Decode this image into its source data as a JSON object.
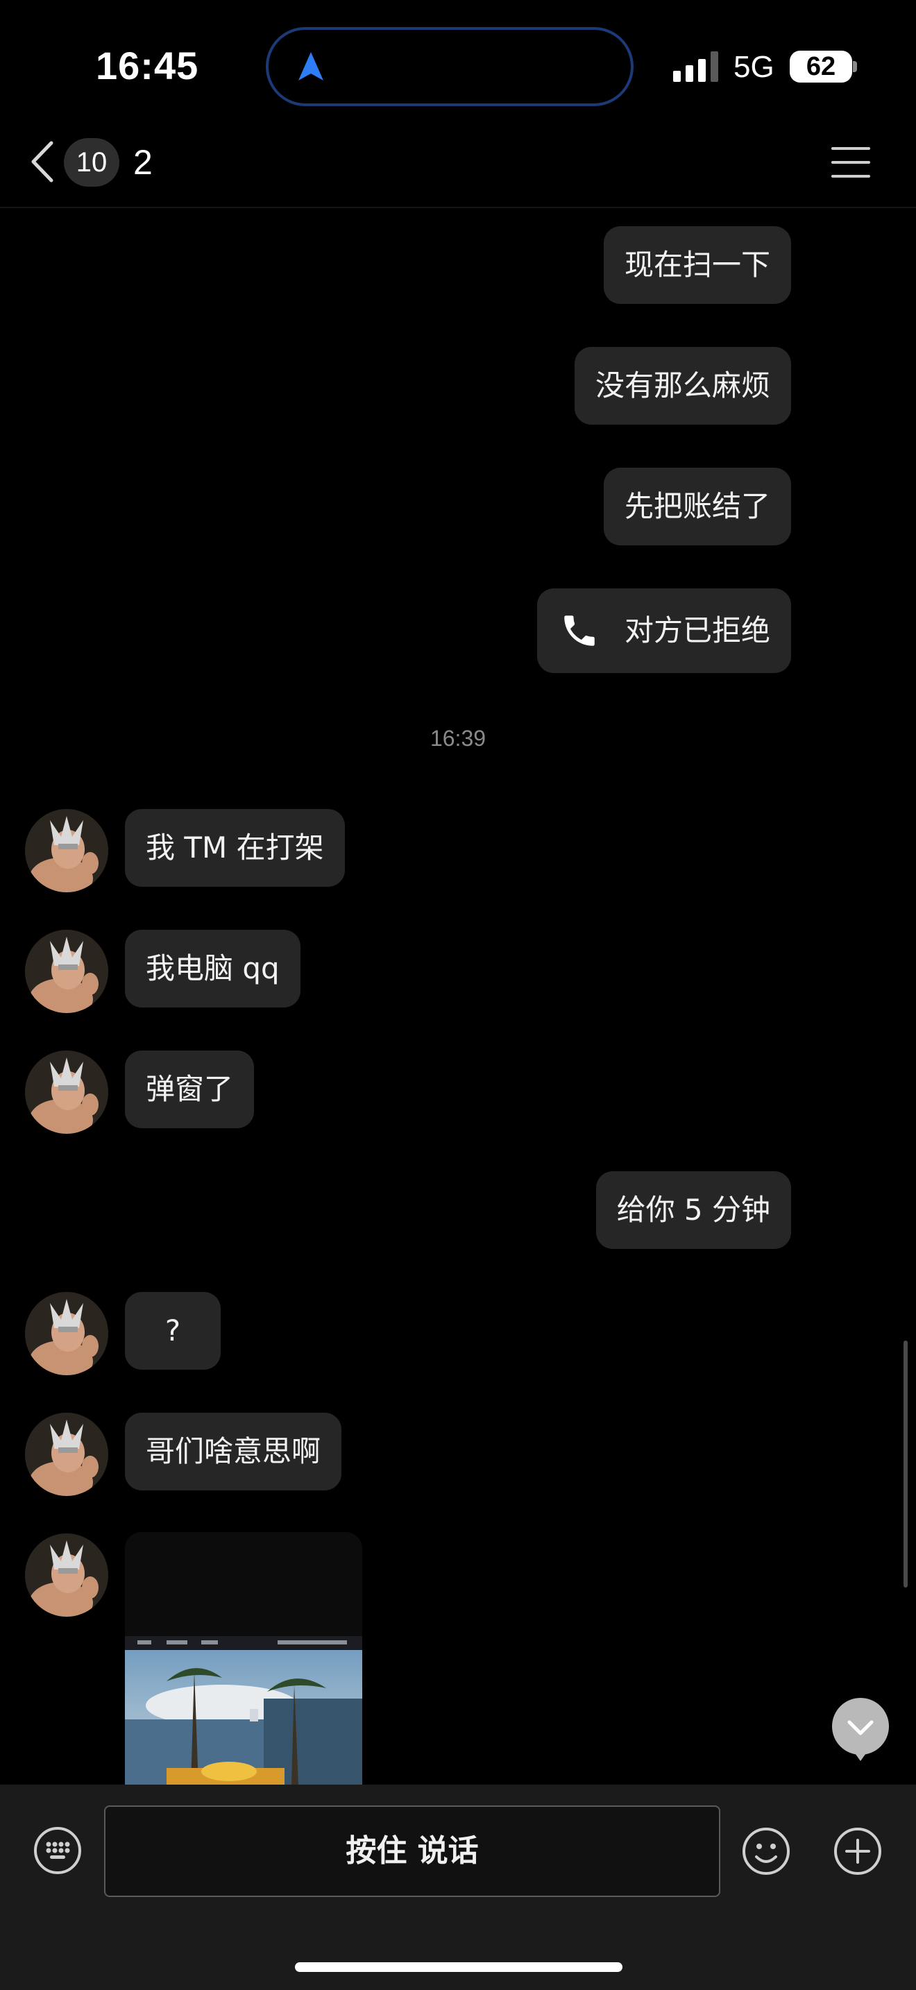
{
  "status_bar": {
    "time": "16:45",
    "network": "5G",
    "battery": "62"
  },
  "nav": {
    "unread_count": "10",
    "title": "2"
  },
  "messages": [
    {
      "side": "out",
      "text": "现在扫一下"
    },
    {
      "side": "out",
      "text": "没有那么麻烦"
    },
    {
      "side": "out",
      "text": "先把账结了"
    },
    {
      "side": "out",
      "type": "call",
      "text": "对方已拒绝",
      "icon": "phone-icon"
    },
    {
      "type": "timestamp",
      "text": "16:39"
    },
    {
      "side": "in",
      "text": "我 TM 在打架"
    },
    {
      "side": "in",
      "text": "我电脑 qq"
    },
    {
      "side": "in",
      "text": "弹窗了"
    },
    {
      "side": "out",
      "text": "给你 5 分钟"
    },
    {
      "side": "in",
      "text": "?"
    },
    {
      "side": "in",
      "text": "哥们啥意思啊"
    },
    {
      "side": "in",
      "type": "image"
    }
  ],
  "input_bar": {
    "hold_to_talk_label": "按住 说话",
    "left_icon": "keyboard-icon",
    "emoji_icon": "emoji-icon",
    "add_icon": "plus-icon"
  },
  "colors": {
    "background": "#000000",
    "bubble": "#262626",
    "accent_nav": "#2f7df6"
  }
}
